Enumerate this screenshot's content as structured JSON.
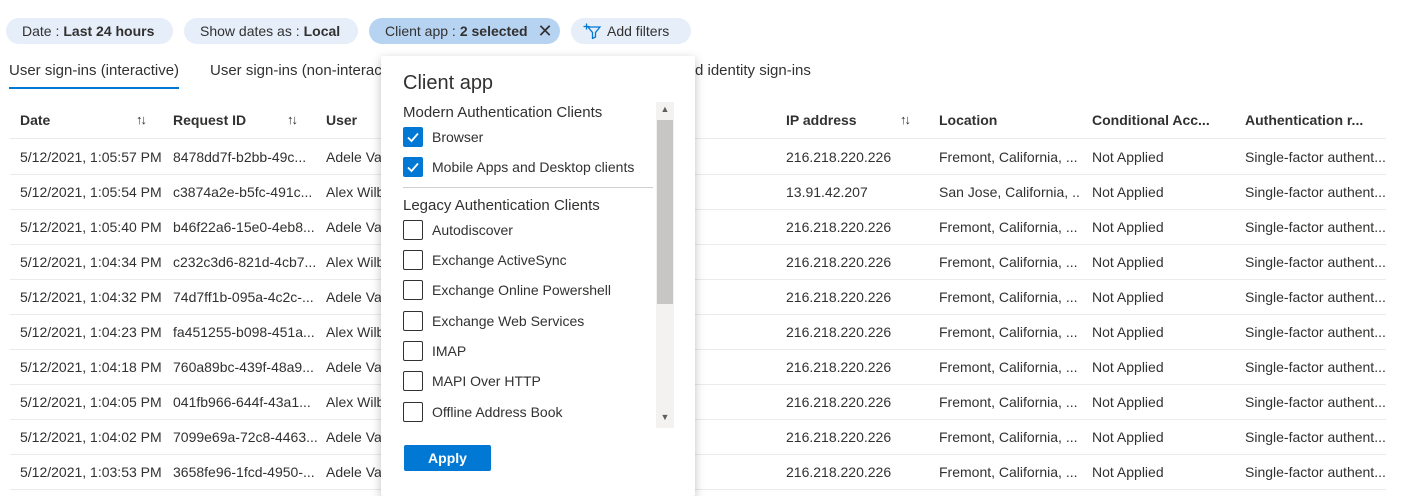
{
  "filters": {
    "date": {
      "label": "Date :",
      "value": "Last 24 hours"
    },
    "show_dates": {
      "label": "Show dates as :",
      "value": "Local"
    },
    "client_app": {
      "label": "Client app :",
      "value": "2 selected"
    },
    "add_filters": "Add filters"
  },
  "tabs": [
    {
      "label": "User sign-ins (interactive)",
      "active": true
    },
    {
      "label": "User sign-ins (non-interac",
      "active": false
    },
    {
      "label": "d identity sign-ins",
      "active": false
    }
  ],
  "columns": {
    "date": "Date",
    "request_id": "Request ID",
    "user": "User",
    "ip": "IP address",
    "location": "Location",
    "conditional": "Conditional Acc...",
    "auth": "Authentication r..."
  },
  "rows": [
    {
      "date": "5/12/2021, 1:05:57 PM",
      "request_id": "8478dd7f-b2bb-49c...",
      "user": "Adele Va",
      "ip": "216.218.220.226",
      "location": "Fremont, California, ...",
      "conditional": "Not Applied",
      "auth": "Single-factor authent..."
    },
    {
      "date": "5/12/2021, 1:05:54 PM",
      "request_id": "c3874a2e-b5fc-491c...",
      "user": "Alex Wilb",
      "ip": "13.91.42.207",
      "location": "San Jose, California, ...",
      "conditional": "Not Applied",
      "auth": "Single-factor authent..."
    },
    {
      "date": "5/12/2021, 1:05:40 PM",
      "request_id": "b46f22a6-15e0-4eb8...",
      "user": "Adele Va",
      "ip": "216.218.220.226",
      "location": "Fremont, California, ...",
      "conditional": "Not Applied",
      "auth": "Single-factor authent..."
    },
    {
      "date": "5/12/2021, 1:04:34 PM",
      "request_id": "c232c3d6-821d-4cb7...",
      "user": "Alex Wilb",
      "ip": "216.218.220.226",
      "location": "Fremont, California, ...",
      "conditional": "Not Applied",
      "auth": "Single-factor authent..."
    },
    {
      "date": "5/12/2021, 1:04:32 PM",
      "request_id": "74d7ff1b-095a-4c2c-...",
      "user": "Adele Va",
      "ip": "216.218.220.226",
      "location": "Fremont, California, ...",
      "conditional": "Not Applied",
      "auth": "Single-factor authent..."
    },
    {
      "date": "5/12/2021, 1:04:23 PM",
      "request_id": "fa451255-b098-451a...",
      "user": "Alex Wilb",
      "ip": "216.218.220.226",
      "location": "Fremont, California, ...",
      "conditional": "Not Applied",
      "auth": "Single-factor authent..."
    },
    {
      "date": "5/12/2021, 1:04:18 PM",
      "request_id": "760a89bc-439f-48a9...",
      "user": "Adele Va",
      "ip": "216.218.220.226",
      "location": "Fremont, California, ...",
      "conditional": "Not Applied",
      "auth": "Single-factor authent..."
    },
    {
      "date": "5/12/2021, 1:04:05 PM",
      "request_id": "041fb966-644f-43a1...",
      "user": "Alex Wilb",
      "ip": "216.218.220.226",
      "location": "Fremont, California, ...",
      "conditional": "Not Applied",
      "auth": "Single-factor authent..."
    },
    {
      "date": "5/12/2021, 1:04:02 PM",
      "request_id": "7099e69a-72c8-4463...",
      "user": "Adele Va",
      "ip": "216.218.220.226",
      "location": "Fremont, California, ...",
      "conditional": "Not Applied",
      "auth": "Single-factor authent..."
    },
    {
      "date": "5/12/2021, 1:03:53 PM",
      "request_id": "3658fe96-1fcd-4950-...",
      "user": "Adele Va",
      "ip": "216.218.220.226",
      "location": "Fremont, California, ...",
      "conditional": "Not Applied",
      "auth": "Single-factor authent..."
    }
  ],
  "popup": {
    "title": "Client app",
    "groups": [
      {
        "heading": "Modern Authentication Clients",
        "items": [
          {
            "label": "Browser",
            "checked": true
          },
          {
            "label": "Mobile Apps and Desktop clients",
            "checked": true
          }
        ]
      },
      {
        "heading": "Legacy Authentication Clients",
        "items": [
          {
            "label": "Autodiscover",
            "checked": false
          },
          {
            "label": "Exchange ActiveSync",
            "checked": false
          },
          {
            "label": "Exchange Online Powershell",
            "checked": false
          },
          {
            "label": "Exchange Web Services",
            "checked": false
          },
          {
            "label": "IMAP",
            "checked": false
          },
          {
            "label": "MAPI Over HTTP",
            "checked": false
          },
          {
            "label": "Offline Address Book",
            "checked": false
          }
        ]
      }
    ],
    "apply": "Apply"
  },
  "colors": {
    "accent": "#0078d4",
    "pill": "#e5eef9",
    "pill_selected": "#b7d3f2"
  }
}
